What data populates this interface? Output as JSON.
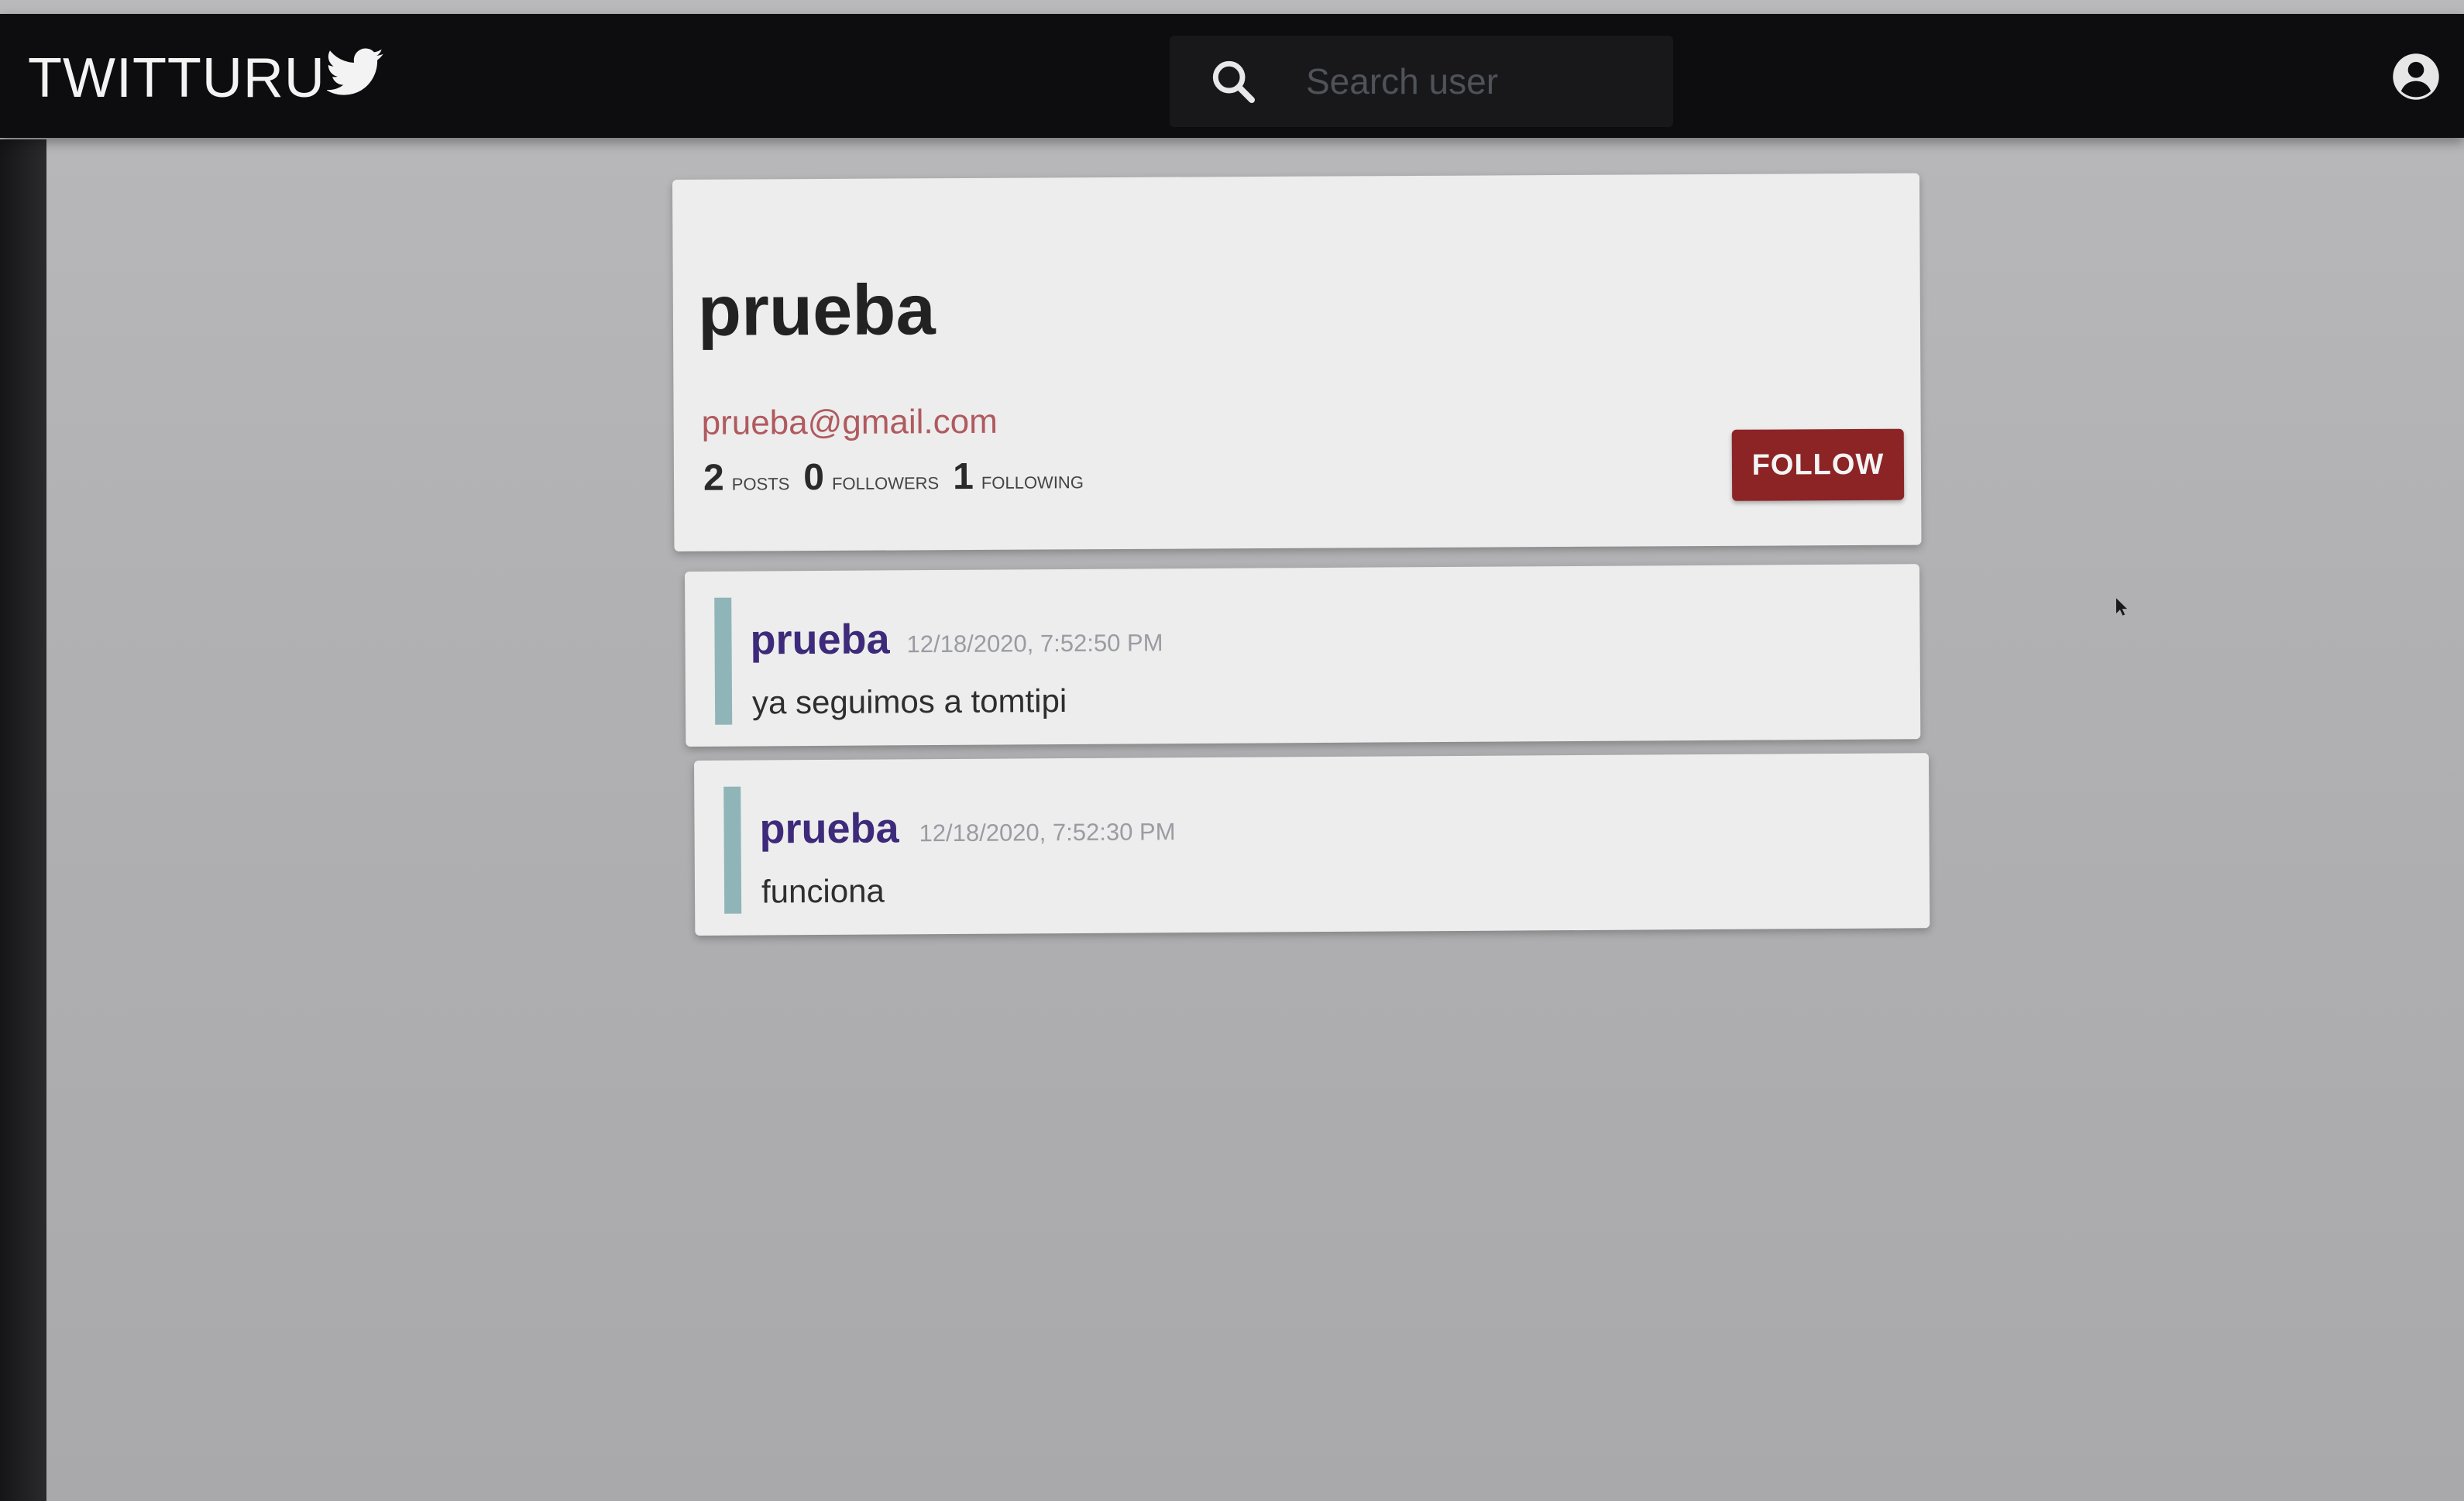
{
  "app": {
    "brand": "TWITTURU",
    "brand_icon": "bird-icon"
  },
  "search": {
    "placeholder": "Search user",
    "value": ""
  },
  "profile": {
    "name": "prueba",
    "email": "prueba@gmail.com",
    "stats": [
      {
        "value": "2",
        "label": "POSTS"
      },
      {
        "value": "0",
        "label": "FOLLOWERS"
      },
      {
        "value": "1",
        "label": "FOLLOWING"
      }
    ],
    "follow_label": "FOLLOW"
  },
  "posts": [
    {
      "author": "prueba",
      "timestamp": "12/18/2020, 7:52:50 PM",
      "text": "ya seguimos a tomtipi"
    },
    {
      "author": "prueba",
      "timestamp": "12/18/2020, 7:52:30 PM",
      "text": "funciona"
    }
  ],
  "colors": {
    "navbar": "#0d0d0f",
    "follow_button": "#8c2426",
    "author": "#3d2a7a",
    "email": "#b05a5f",
    "post_accent": "#8fb5b8",
    "page_background": "#b3b3b5"
  }
}
